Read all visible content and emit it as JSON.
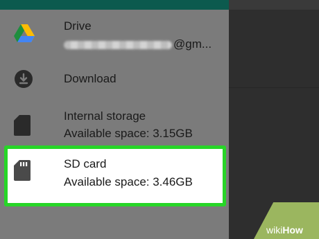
{
  "drawer": {
    "items": [
      {
        "label": "Drive",
        "sub_suffix": "@gm..."
      },
      {
        "label": "Download"
      },
      {
        "label": "Internal storage",
        "sub": "Available space: 3.15GB"
      },
      {
        "label": "SD card",
        "sub": "Available space: 3.46GB"
      }
    ]
  },
  "watermark": {
    "wiki": "wiki",
    "how": "How"
  },
  "colors": {
    "highlight": "#27d627",
    "drawer_bg": "#7b7b7b",
    "teal_bar": "#0c5a4e"
  }
}
